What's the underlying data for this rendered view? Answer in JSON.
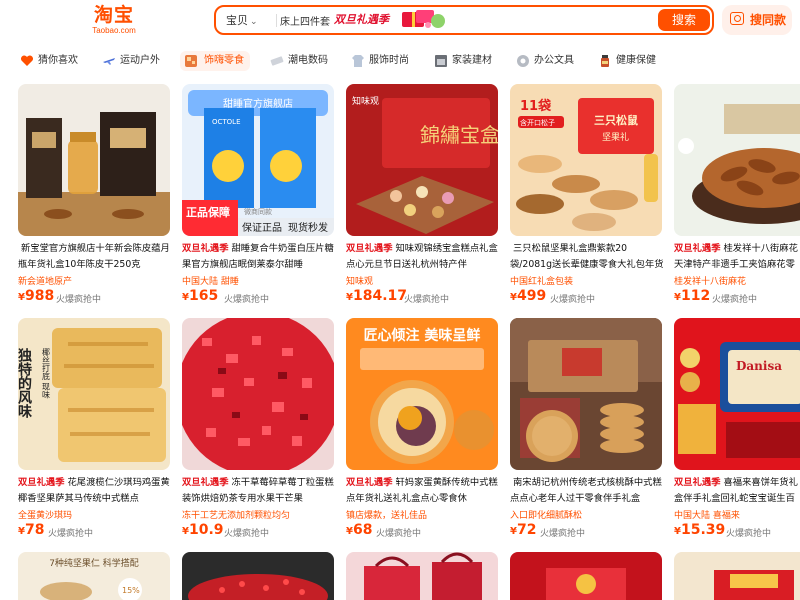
{
  "header": {
    "logo_text": "淘宝",
    "logo_sub": "Taobao.com",
    "search_scope": "宝贝",
    "search_query": "床上四件套",
    "promo_tag": "双旦礼遇季",
    "search_button": "搜索",
    "photo_search": "搜同款"
  },
  "categories": [
    {
      "label": "猜你喜欢",
      "icon": "heart-icon",
      "color": "#ff5000"
    },
    {
      "label": "运动户外",
      "icon": "plane-icon",
      "color": "#4a6fd8"
    },
    {
      "label": "饰嗨零食",
      "icon": "snack-icon",
      "color": "#e8793c",
      "active": true
    },
    {
      "label": "潮电数码",
      "icon": "phone-icon",
      "color": "#8a8fa0"
    },
    {
      "label": "服饰时尚",
      "icon": "shirt-icon",
      "color": "#b9c6d8"
    },
    {
      "label": "家装建材",
      "icon": "house-icon",
      "color": "#6b6f76"
    },
    {
      "label": "办公文具",
      "icon": "tape-icon",
      "color": "#9aa0a8"
    },
    {
      "label": "健康保健",
      "icon": "bottle-icon",
      "color": "#c7502a"
    }
  ],
  "products": [
    {
      "badge": "",
      "title": "新宝堂官方旗舰店十年新会陈皮蕴月瓶年货礼盒10年陈皮干250克",
      "tag": "新会道地原产",
      "price": "988",
      "hot": "火爆疯抢中"
    },
    {
      "badge": "双旦礼遇季",
      "title": "甜睡复合牛奶蛋白压片糖果官方旗舰店眠倒莱泰尔甜睡",
      "tag": "中国大陆 甜睡",
      "price": "165",
      "hot": "火爆疯抢中"
    },
    {
      "badge": "双旦礼遇季",
      "title": "知味观锦绣宝盒糕点礼盒点心元旦节日送礼杭州特产伴",
      "tag": "知味观",
      "price": "184.17",
      "hot": "火爆疯抢中"
    },
    {
      "badge": "",
      "title": "三只松鼠坚果礼盒鼎紫款20袋/2081g送长辈健康零食大礼包年货送",
      "tag": "中国红礼盒包装",
      "price": "499",
      "hot": "火爆疯抢中"
    },
    {
      "badge": "双旦礼遇季",
      "title": "桂发祥十八街麻花天津特产非遗手工夹馅麻花零食",
      "tag": "桂发祥十八街麻花",
      "price": "112",
      "hot": "火爆疯抢中"
    },
    {
      "badge": "双旦礼遇季",
      "title": "花尾渡榄仁沙琪玛鸡蛋黄椰香坚果萨其马传统中式糕点",
      "tag": "全蛋黄沙琪玛",
      "price": "78",
      "hot": "火爆疯抢中"
    },
    {
      "badge": "双旦礼遇季",
      "title": "冻干草莓碎草莓丁粒蛋糕装饰烘焙奶茶专用水果干芒果",
      "tag": "冻干工艺无添加剂颗粒均匀",
      "price": "10.9",
      "hot": "火爆疯抢中"
    },
    {
      "badge": "双旦礼遇季",
      "title": "轩妈家蛋黄酥传统中式糕点年货礼送礼礼盒点心零食休",
      "tag": "镇店爆款，送礼佳品",
      "price": "68",
      "hot": "火爆疯抢中"
    },
    {
      "badge": "",
      "title": "南宋胡记杭州传统老式核桃酥中式糕点点心老年人过干零食伴手礼盒",
      "tag": "入口即化细腻酥松",
      "price": "72",
      "hot": "火爆疯抢中"
    },
    {
      "badge": "双旦礼遇季",
      "title": "喜福来喜饼年货礼盒伴手礼盒回礼蛇宝宝诞生百日",
      "tag": "中国大陆 喜福来",
      "price": "15.39",
      "hot": "火爆疯抢中"
    },
    {
      "badge": "",
      "title": "",
      "tag": "",
      "price": "",
      "hot": ""
    },
    {
      "badge": "",
      "title": "",
      "tag": "",
      "price": "",
      "hot": ""
    },
    {
      "badge": "",
      "title": "",
      "tag": "",
      "price": "",
      "hot": ""
    },
    {
      "badge": "",
      "title": "",
      "tag": "",
      "price": "",
      "hot": ""
    },
    {
      "badge": "",
      "title": "",
      "tag": "",
      "price": "",
      "hot": ""
    }
  ],
  "image_text": {
    "p2_store": "甜睡官方旗舰店",
    "p2_brand": "OCTOLE",
    "p2_label1": "正品保障",
    "p2_label2": "保证正品",
    "p2_label3": "现货秒发",
    "p2_sublabel": "微商同款",
    "p3_brand": "知味观",
    "p3_box": "錦繡宝盒",
    "p4_box": "三只松鼠",
    "p4_sub": "坚果礼",
    "p4_count": "11袋",
    "p4_note": "含开口松子",
    "p6_text1": "独特的风味",
    "p6_text2": "椰丝打底 现味",
    "p8_title": "匠心倾注 美味呈鲜",
    "p10_brand": "Danisa",
    "p11_text": "7种纯坚果仁 科学搭配",
    "p11_pct": "15%"
  },
  "colors": {
    "accent": "#ff5000",
    "price": "#ff4400",
    "badge": "#e4141b"
  }
}
